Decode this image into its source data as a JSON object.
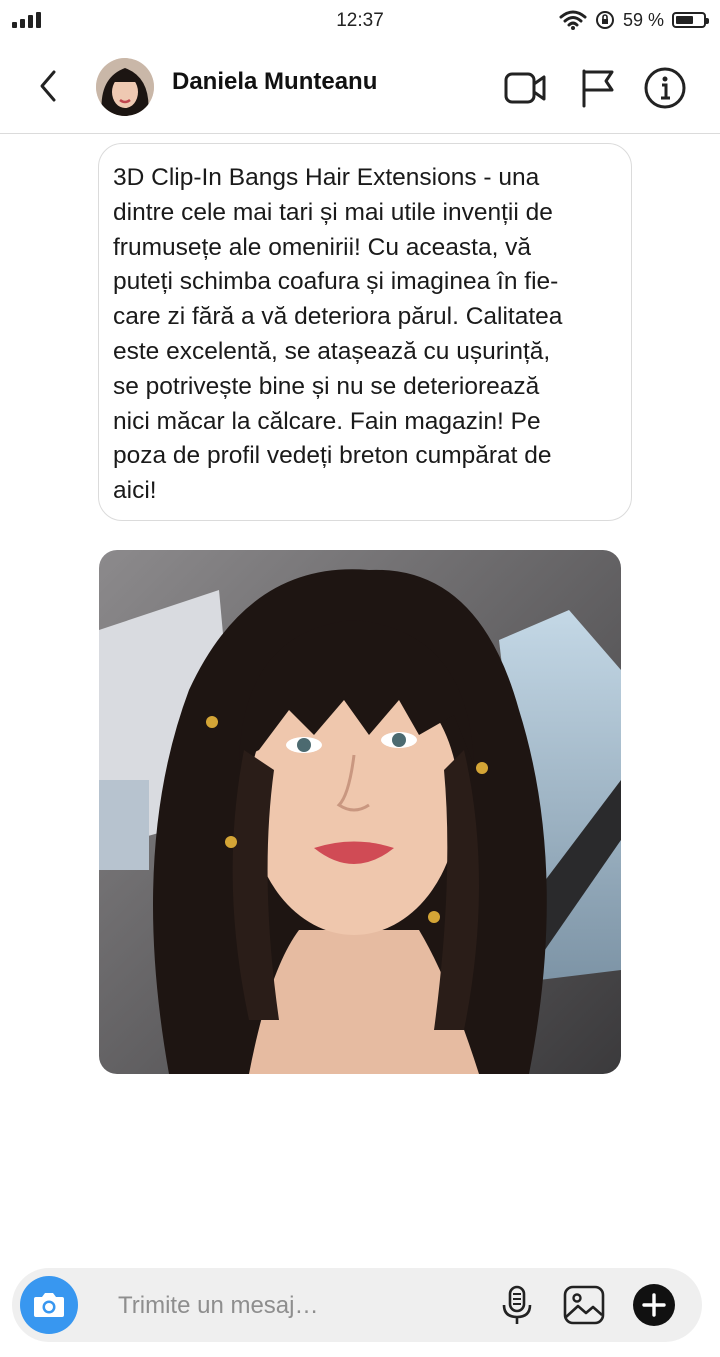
{
  "status": {
    "time": "12:37",
    "battery": "59 %"
  },
  "header": {
    "contact_name": "Daniela Munteanu",
    "icons": [
      "back-chevron-icon",
      "video-call-icon",
      "flag-icon",
      "info-icon"
    ]
  },
  "message": {
    "lines": [
      "3D Clip-In Bangs Hair Extensions - una",
      "dintre cele mai tari și mai utile invenții de",
      "frumusețe ale omenirii! Cu aceasta, vă",
      "puteți schimba coafura și imaginea în fie-",
      "care zi fără a vă deteriora părul. Calitatea",
      "este excelentă, se atașează cu ușurință,",
      "se potrivește bine și nu se deteriorează",
      "nici măcar la călcare. Fain magazin! Pe",
      "poza de profil vedeți breton cumpărat de",
      "aici!"
    ]
  },
  "composer": {
    "placeholder": "Trimite un mesaj…",
    "icons": [
      "camera-icon",
      "microphone-icon",
      "gallery-icon",
      "plus-icon"
    ]
  }
}
